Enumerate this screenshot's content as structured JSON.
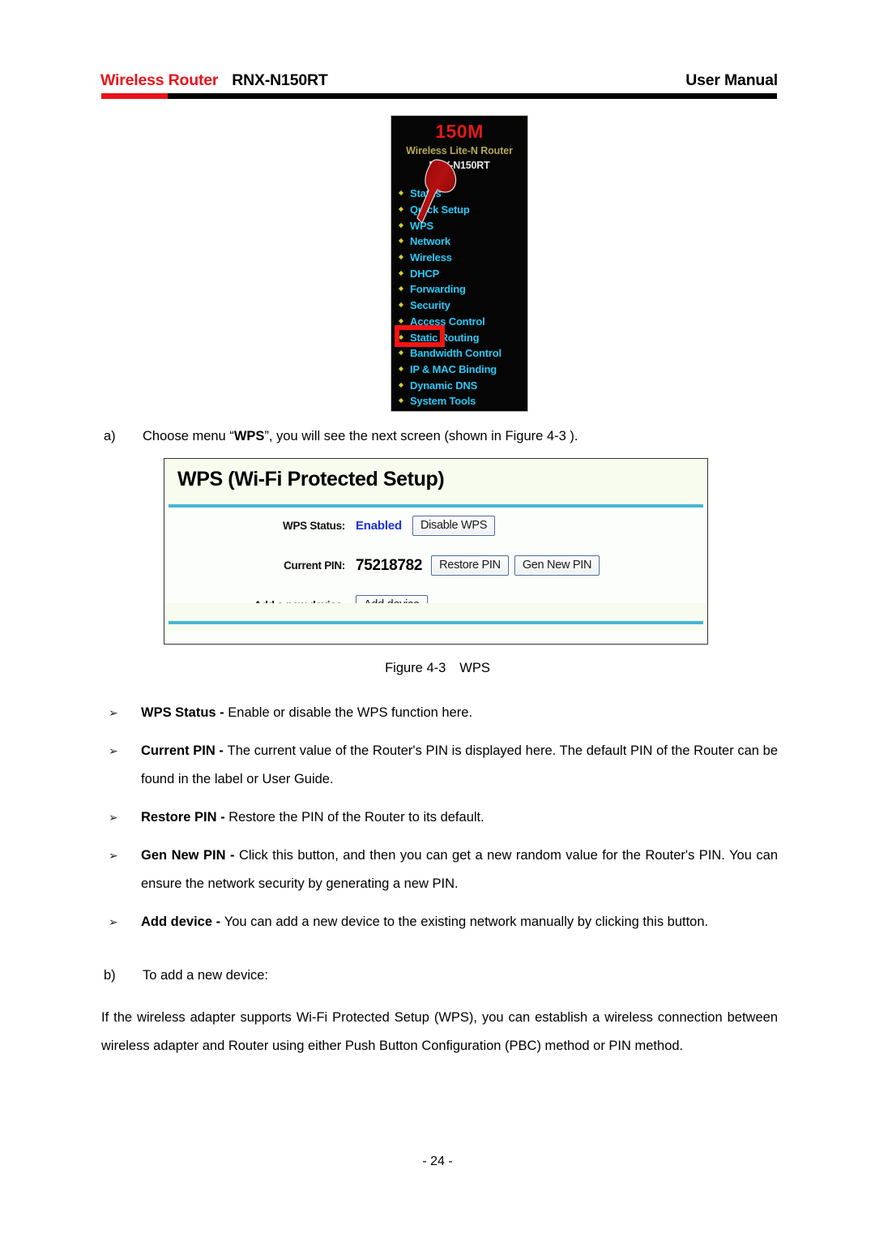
{
  "header": {
    "brand": "Wireless Router",
    "model": "RNX-N150RT",
    "doc_type": "User Manual",
    "rule_red_color": "#e8131b",
    "rule_black_color": "#000000"
  },
  "router_screenshot": {
    "banner_speed": "150M",
    "banner_subtitle": "Wireless Lite-N Router",
    "banner_model": "RNX-N150RT",
    "speed_color": "#e01b16",
    "subtitle_color": "#b5aa56",
    "link_color": "#2bc8f5",
    "bullet_color": "#d3cf37",
    "background_color": "#050505",
    "highlight_color": "#f41414",
    "menu_items": [
      {
        "label": "Status"
      },
      {
        "label": "Quick Setup"
      },
      {
        "label": "WPS",
        "highlighted": true
      },
      {
        "label": "Network"
      },
      {
        "label": "Wireless"
      },
      {
        "label": "DHCP"
      },
      {
        "label": "Forwarding"
      },
      {
        "label": "Security"
      },
      {
        "label": "Access Control"
      },
      {
        "label": "Static Routing"
      },
      {
        "label": "Bandwidth Control"
      },
      {
        "label": "IP & MAC Binding"
      },
      {
        "label": "Dynamic DNS"
      },
      {
        "label": "System Tools"
      }
    ]
  },
  "step_a": {
    "marker": "a)",
    "text_before": "Choose menu “",
    "emphasis": "WPS",
    "text_after": "”, you will see the next screen (shown in Figure 4-3 )."
  },
  "wps_panel": {
    "title": "WPS (Wi-Fi Protected Setup)",
    "rule_color": "#45b6d4",
    "title_bg": "#f7fcee",
    "body_bg": "#fcfefb",
    "rows": {
      "status": {
        "label": "WPS Status:",
        "value": "Enabled",
        "value_color": "#1b31e0",
        "button": "Disable WPS"
      },
      "pin": {
        "label": "Current PIN:",
        "value": "75218782",
        "button_restore": "Restore PIN",
        "button_gen": "Gen New PIN"
      },
      "add_device": {
        "label": "Add a new device:",
        "button": "Add device"
      }
    }
  },
  "figure_caption": {
    "number": "Figure 4-3",
    "name": "WPS"
  },
  "bullets": [
    {
      "term": "WPS Status - ",
      "description": "Enable or disable the WPS function here."
    },
    {
      "term": "Current PIN - ",
      "description": "The current value of the Router's PIN is displayed here. The default PIN of the Router can be found in the label or User Guide."
    },
    {
      "term": "Restore PIN - ",
      "description": "Restore the PIN of the Router to its default."
    },
    {
      "term": "Gen New PIN - ",
      "description": "Click this button, and then you can get a new random value for the Router's PIN. You can ensure the network security by generating a new PIN."
    },
    {
      "term": "Add device - ",
      "description": "You can add a new device to the existing network manually by clicking this button."
    }
  ],
  "step_b": {
    "marker": "b)",
    "text": "To add a new device:"
  },
  "closing_paragraph": "If the wireless adapter supports Wi-Fi Protected Setup (WPS), you can establish a wireless connection between wireless adapter and Router using either Push Button Configuration (PBC) method or PIN method.",
  "page_number": "- 24 -"
}
